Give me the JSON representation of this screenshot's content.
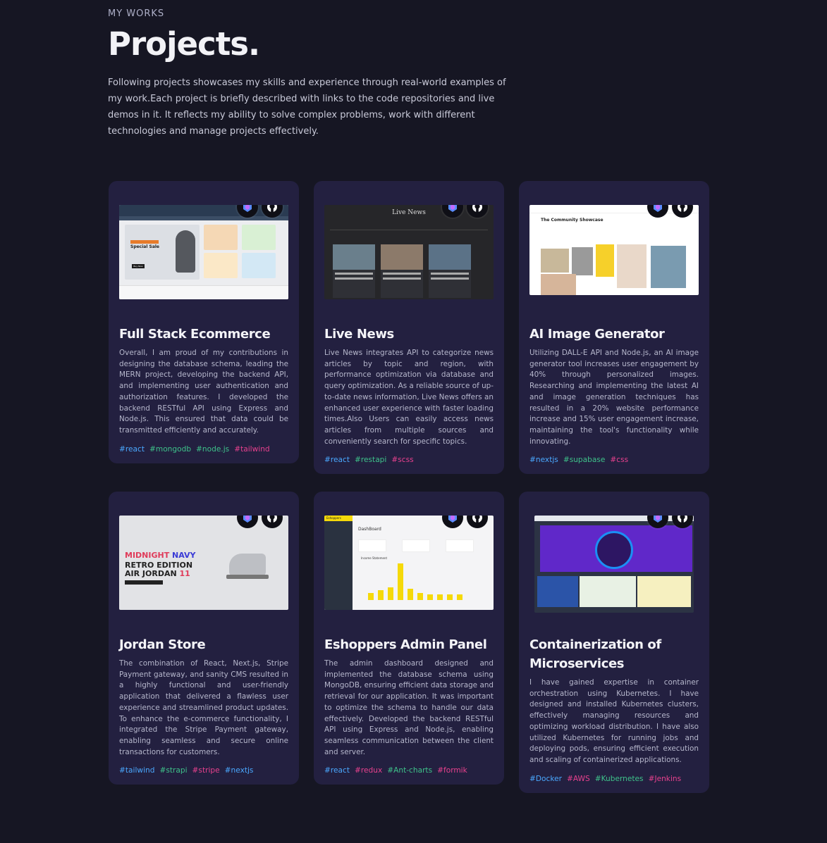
{
  "header": {
    "subtitle": "MY WORKS",
    "title": "Projects.",
    "intro": "Following projects showcases my skills and experience through real-world examples of my work.Each project is briefly described with links to the code repositories and live demos in it. It reflects my ability to solve complex problems, work with different technologies and manage projects effectively."
  },
  "icons": {
    "live": "live-demo-icon",
    "github": "github-icon"
  },
  "colors": {
    "tag_blue": "#4aa8ff",
    "tag_green": "#3ec28a",
    "tag_pink": "#e8418e",
    "card_bg": "#232040",
    "page_bg": "#161623"
  },
  "projects": [
    {
      "title": "Full Stack Ecommerce",
      "description": "Overall, I am proud of my contributions in designing the database schema, leading the MERN project, developing the backend API, and implementing user authentication and authorization features. I developed the backend RESTful API using Express and Node.js. This ensured that data could be transmitted efficiently and accurately.",
      "tags": [
        "#react",
        "#mongodb",
        "#node.js",
        "#tailwind"
      ]
    },
    {
      "title": "Live News",
      "description": "Live News integrates API to categorize news articles by topic and region, with performance optimization via database and query optimization. As a reliable source of up-to-date news information, Live News offers an enhanced user experience with faster loading times.Also Users can easily access news articles from multiple sources and conveniently search for specific topics.",
      "tags": [
        "#react",
        "#restapi",
        "#scss"
      ]
    },
    {
      "title": "AI Image Generator",
      "description": "Utilizing DALL-E API and Node.js, an AI image generator tool increases user engagement by 40% through personalized images. Researching and implementing the latest AI and image generation techniques has resulted in a 20% website performance increase and 15% user engagement increase, maintaining the tool's functionality while innovating.",
      "tags": [
        "#nextjs",
        "#supabase",
        "#css"
      ]
    },
    {
      "title": "Jordan Store",
      "description": "The combination of React, Next.js, Stripe Payment gateway, and sanity CMS resulted in a highly functional and user-friendly application that delivered a flawless user experience and streamlined product updates. To enhance the e-commerce functionality, I integrated the Stripe Payment gateway, enabling seamless and secure online transactions for customers.",
      "tags": [
        "#tailwind",
        "#strapi",
        "#stripe",
        "#nextjs"
      ]
    },
    {
      "title": "Eshoppers Admin Panel",
      "description": "The admin dashboard designed and implemented the database schema using MongoDB, ensuring efficient data storage and retrieval for our application. It was important to optimize the schema to handle our data effectively. Developed the backend RESTful API using Express and Node.js, enabling seamless communication between the client and server.",
      "tags": [
        "#react",
        "#redux",
        "#Ant-charts",
        "#formik"
      ]
    },
    {
      "title": "Containerization of Microservices",
      "description": "I have gained expertise in container orchestration using Kubernetes. I have designed and installed Kubernetes clusters, effectively managing resources and optimizing workload distribution. I have also utilized Kubernetes for running jobs and deploying pods, ensuring efficient execution and scaling of containerized applications.",
      "tags": [
        "#Docker",
        "#AWS",
        "#Kubernetes",
        "#Jenkins"
      ]
    }
  ],
  "mockups": {
    "ecommerce": {
      "banner": "Special Sale",
      "button": "Buy Now"
    },
    "news": {
      "masthead": "Live News"
    },
    "ai": {
      "heading": "The Community Showcase"
    },
    "jordan": {
      "line1a": "MIDNIGHT ",
      "line1b": "NAVY",
      "line2": "RETRO EDITION",
      "line3a": "AIR JORDAN ",
      "line3b": "11"
    },
    "admin": {
      "brand": "Eshoppers",
      "heading": "DashBoard",
      "chart_title": "Income Statement"
    }
  }
}
